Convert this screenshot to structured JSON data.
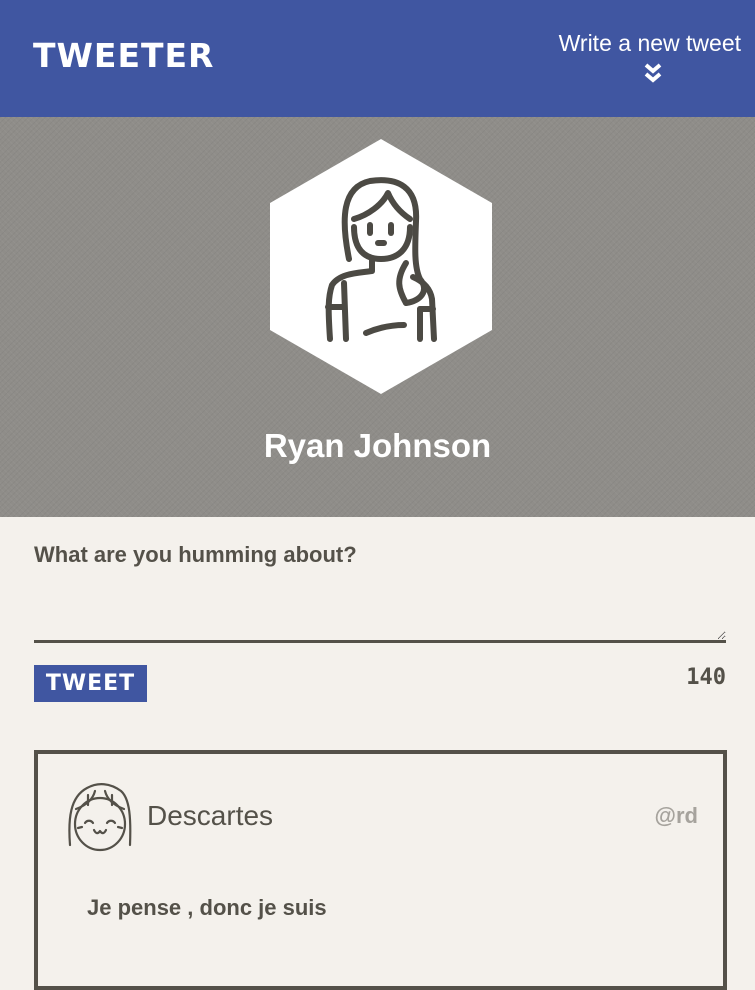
{
  "nav": {
    "brand": "TWEETER",
    "compose_label": "Write a new tweet",
    "compose_icon": "double-chevron-down-icon",
    "color": "#4056a1"
  },
  "profile": {
    "name": "Ryan Johnson",
    "avatar_icon": "user-avatar-hexagon"
  },
  "composer": {
    "placeholder": "What are you humming about?",
    "value": "",
    "button_label": "TWEET",
    "char_counter": "140"
  },
  "tweets": [
    {
      "author": "Descartes",
      "handle": "@rd",
      "text": "Je pense , donc je suis",
      "avatar_icon": "user-avatar-icon"
    }
  ],
  "colors": {
    "accent": "#4056a1",
    "text": "#545149",
    "background": "#f4f1ec",
    "banner": "#8f8d89",
    "handle": "#a6a39d"
  }
}
